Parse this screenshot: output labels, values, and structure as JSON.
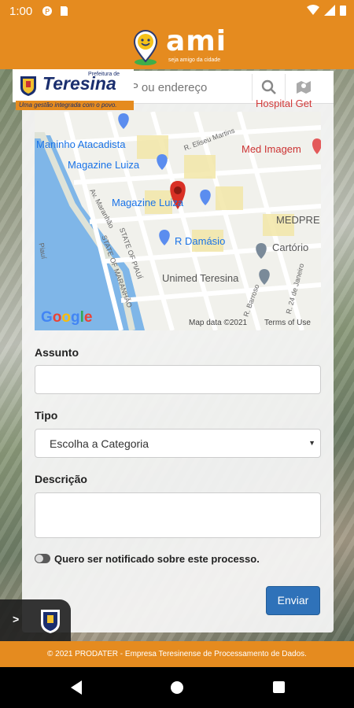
{
  "status_bar": {
    "time": "1:00"
  },
  "header": {
    "app_name": "ami",
    "tagline": "seja amigo da cidade"
  },
  "brand": {
    "prefix": "Prefeitura de",
    "name": "Teresina",
    "slogan": "Uma gestão integrada com o povo."
  },
  "search": {
    "placeholder": "P ou endereço"
  },
  "map": {
    "peek_label": "Hospital Get",
    "places": {
      "maninho": "Maninho Atacadista",
      "magazine1": "Magazine Luiza",
      "medimagem": "Med Imagem",
      "magazine2": "Magazine Luiza",
      "damasio": "R Damásio",
      "medpre": "MEDPRE",
      "cartorio": "Cartório",
      "unimed": "Unimed Teresina"
    },
    "streets": {
      "eliseu": "R. Eliseu Martins",
      "maranhao": "Av. Maranhão",
      "state_piaui": "STATE OF PIAUÍ",
      "state_maranhao": "STATE OF MARANHÃO",
      "piaui": "Piauí",
      "junho": "R. 24 de Janeiro",
      "barroso": "R. Barroso"
    },
    "google": "Google",
    "map_data": "Map data ©2021",
    "terms": "Terms of Use"
  },
  "form": {
    "subject_label": "Assunto",
    "subject_value": "",
    "type_label": "Tipo",
    "type_selected": "Escolha a Categoria",
    "description_label": "Descrição",
    "description_value": "",
    "notify_label": "Quero ser notificado sobre este processo.",
    "notify_on": false,
    "submit_label": "Enviar"
  },
  "footer": {
    "text": "© 2021 PRODATER - Empresa Teresinense de Processamento de Dados."
  },
  "colors": {
    "brand_orange": "#e58b1f",
    "primary_blue": "#2f72b9",
    "navy": "#1a2e6e"
  }
}
